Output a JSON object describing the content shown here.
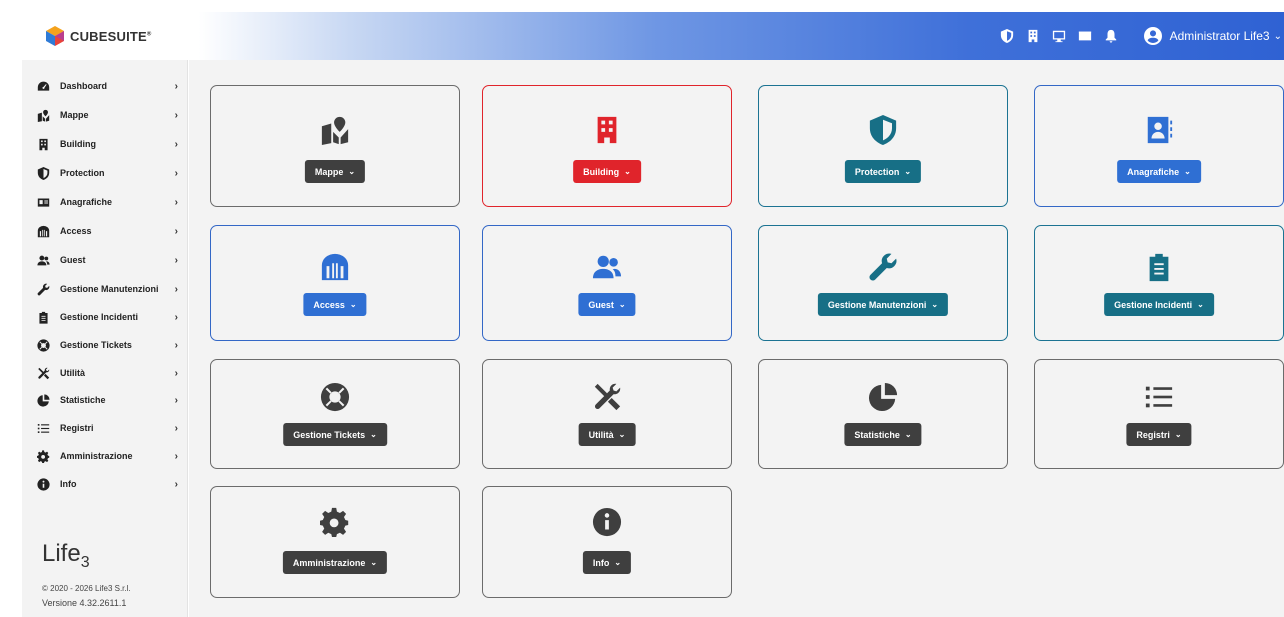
{
  "header": {
    "logo_text": "CUBESUITE",
    "logo_mark": "®",
    "user_name": "Administrator Life3",
    "icons": [
      "shield-icon",
      "building-icon",
      "monitor-icon",
      "envelope-icon",
      "bell-icon"
    ]
  },
  "sidebar": {
    "items": [
      {
        "label": "Dashboard",
        "icon": "dashboard-icon"
      },
      {
        "label": "Mappe",
        "icon": "map-icon"
      },
      {
        "label": "Building",
        "icon": "building-icon"
      },
      {
        "label": "Protection",
        "icon": "shield-icon"
      },
      {
        "label": "Anagrafiche",
        "icon": "id-card-icon"
      },
      {
        "label": "Access",
        "icon": "gate-icon"
      },
      {
        "label": "Guest",
        "icon": "users-icon"
      },
      {
        "label": "Gestione Manutenzioni",
        "icon": "wrench-icon"
      },
      {
        "label": "Gestione Incidenti",
        "icon": "clipboard-icon"
      },
      {
        "label": "Gestione Tickets",
        "icon": "life-ring-icon"
      },
      {
        "label": "Utilità",
        "icon": "tools-icon"
      },
      {
        "label": "Statistiche",
        "icon": "pie-chart-icon"
      },
      {
        "label": "Registri",
        "icon": "list-icon"
      },
      {
        "label": "Amministrazione",
        "icon": "gear-icon"
      },
      {
        "label": "Info",
        "icon": "info-icon"
      }
    ],
    "chevron": "›",
    "brand": "Life",
    "brand_sub": "3",
    "copyright": "© 2020 - 2026 Life3 S.r.l.",
    "version": "Versione 4.32.2611.1"
  },
  "cards": [
    {
      "label": "Mappe",
      "icon": "map-icon",
      "style": "gray"
    },
    {
      "label": "Building",
      "icon": "building-icon",
      "style": "red"
    },
    {
      "label": "Protection",
      "icon": "shield-icon",
      "style": "teal"
    },
    {
      "label": "Anagrafiche",
      "icon": "id-card-icon",
      "style": "blue"
    },
    {
      "label": "Access",
      "icon": "gate-icon",
      "style": "blue"
    },
    {
      "label": "Guest",
      "icon": "users-icon",
      "style": "blue"
    },
    {
      "label": "Gestione Manutenzioni",
      "icon": "wrench-icon",
      "style": "teal"
    },
    {
      "label": "Gestione Incidenti",
      "icon": "clipboard-icon",
      "style": "teal"
    },
    {
      "label": "Gestione Tickets",
      "icon": "life-ring-icon",
      "style": "gray"
    },
    {
      "label": "Utilità",
      "icon": "tools-icon",
      "style": "gray"
    },
    {
      "label": "Statistiche",
      "icon": "pie-chart-icon",
      "style": "gray"
    },
    {
      "label": "Registri",
      "icon": "list-icon",
      "style": "gray"
    },
    {
      "label": "Amministrazione",
      "icon": "gear-icon",
      "style": "gray"
    },
    {
      "label": "Info",
      "icon": "info-icon",
      "style": "gray"
    }
  ],
  "colors": {
    "gray": "#3f3f3f",
    "red": "#e0242b",
    "blue": "#2f6fd3",
    "teal": "#176f86"
  }
}
